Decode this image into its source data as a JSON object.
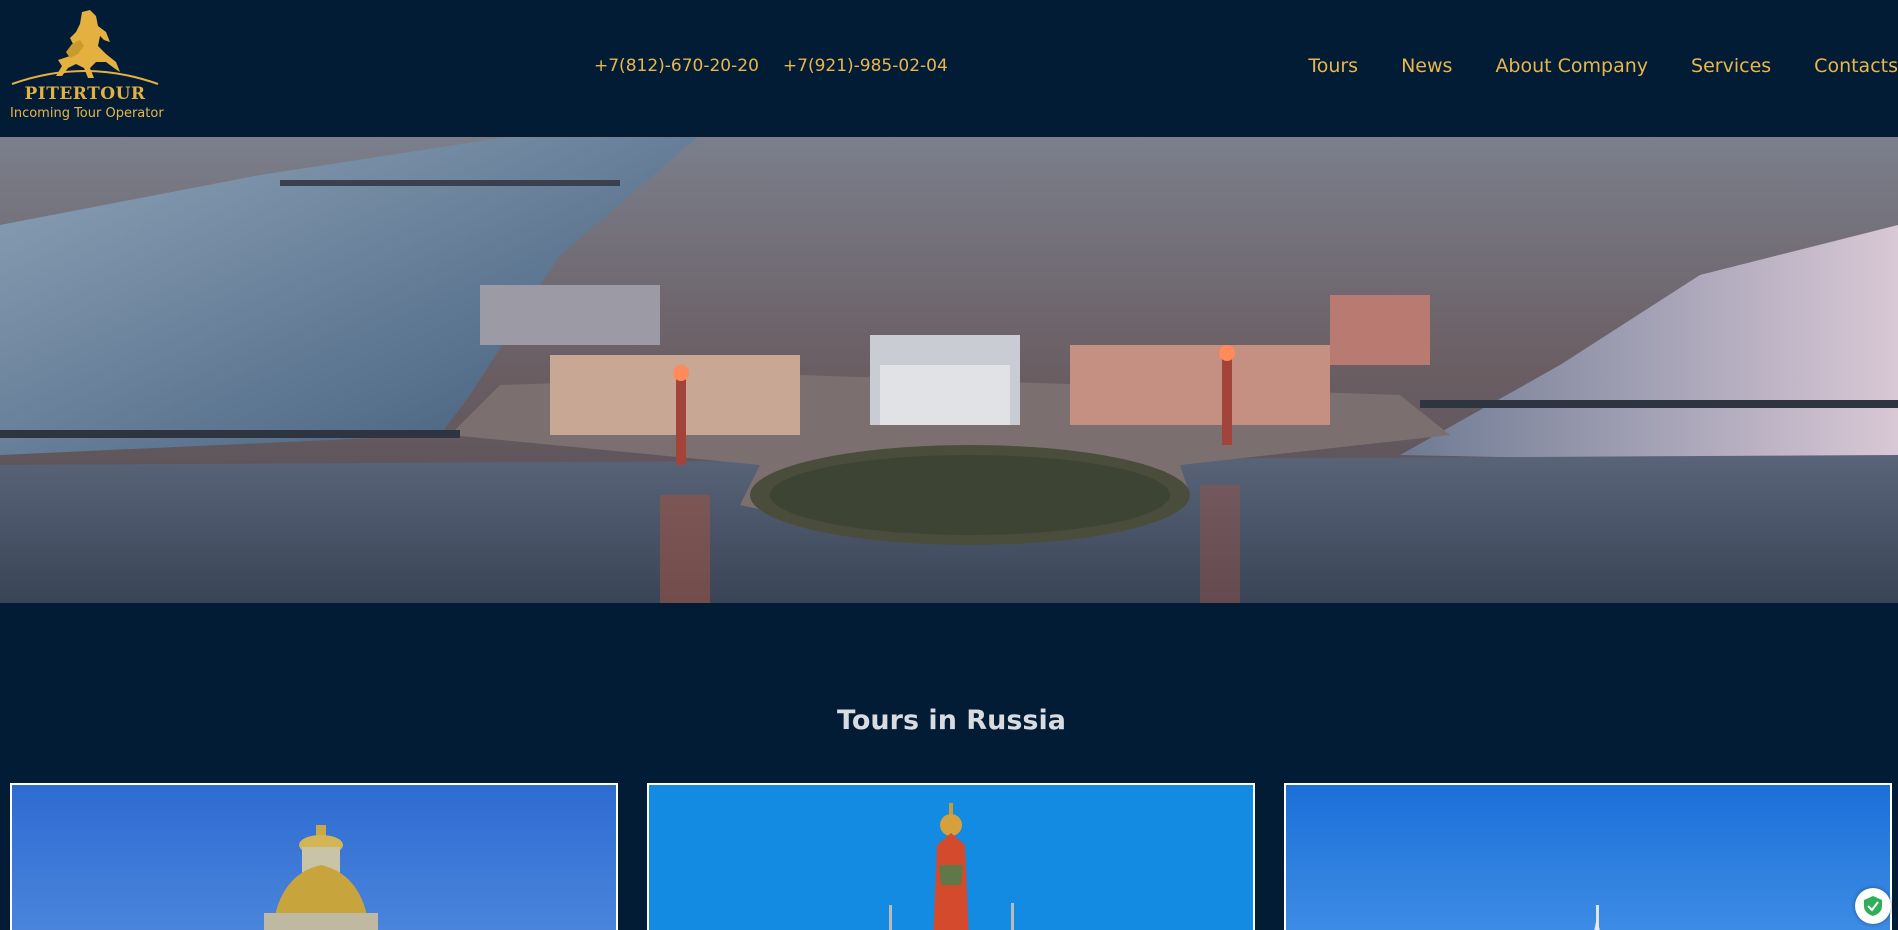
{
  "brand": {
    "name": "PITERTOUR",
    "tagline": "Incoming Tour Operator",
    "logo_icon": "rearing-horse-icon"
  },
  "contacts": {
    "phone1": "+7(812)-670-20-20",
    "phone2": "+7(921)-985-02-04"
  },
  "nav": {
    "tours": "Tours",
    "news": "News",
    "about": "About Company",
    "services": "Services",
    "contacts": "Contacts"
  },
  "hero": {
    "image": "aerial-view-saint-petersburg-vasilyevsky-island-spit"
  },
  "tours_section": {
    "title": "Tours in Russia",
    "cards": [
      {
        "image": "st-isaacs-cathedral-dome"
      },
      {
        "image": "st-basils-cathedral-dome"
      },
      {
        "image": "church-spire-blue-sky"
      }
    ]
  },
  "colors": {
    "background": "#021c35",
    "accent": "#e8b64a",
    "title_text": "#d8dbe0"
  },
  "widgets": {
    "security_badge_icon": "shield-check-icon"
  }
}
